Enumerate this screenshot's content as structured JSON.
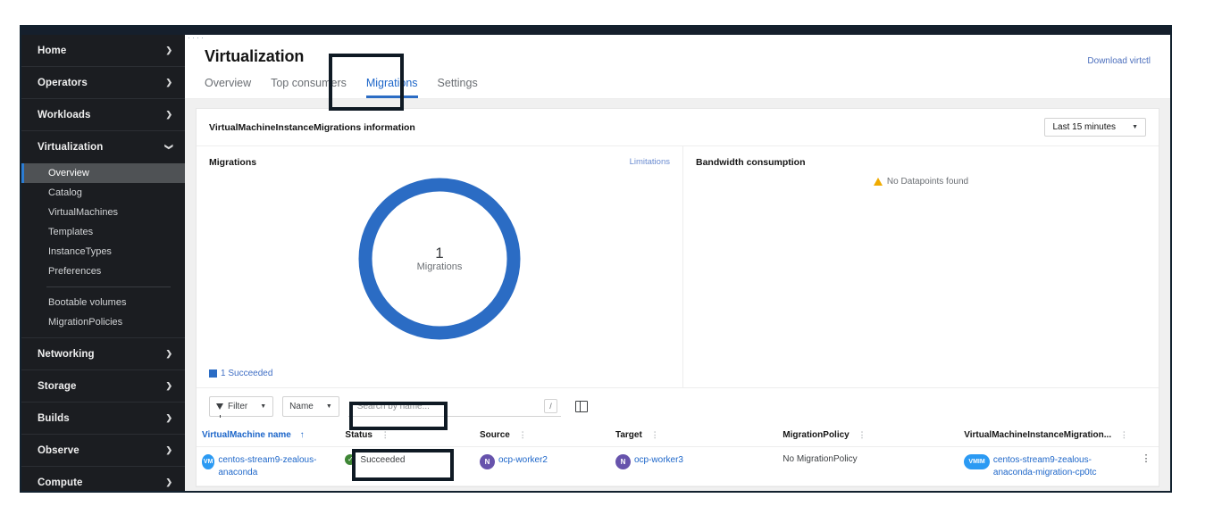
{
  "masthead": {
    "clipped_text": "····"
  },
  "sidebar": {
    "groups": [
      {
        "label": "Home",
        "expanded": false,
        "caret": "chevron-right-icon"
      },
      {
        "label": "Operators",
        "expanded": false,
        "caret": "chevron-right-icon"
      },
      {
        "label": "Workloads",
        "expanded": false,
        "caret": "chevron-right-icon"
      },
      {
        "label": "Virtualization",
        "expanded": true,
        "caret": "chevron-down-icon"
      },
      {
        "label": "Networking",
        "expanded": false,
        "caret": "chevron-right-icon"
      },
      {
        "label": "Storage",
        "expanded": false,
        "caret": "chevron-right-icon"
      },
      {
        "label": "Builds",
        "expanded": false,
        "caret": "chevron-right-icon"
      },
      {
        "label": "Observe",
        "expanded": false,
        "caret": "chevron-right-icon"
      },
      {
        "label": "Compute",
        "expanded": false,
        "caret": "chevron-right-icon"
      }
    ],
    "virtualization_items": [
      {
        "label": "Overview",
        "active": true
      },
      {
        "label": "Catalog",
        "active": false
      },
      {
        "label": "VirtualMachines",
        "active": false
      },
      {
        "label": "Templates",
        "active": false
      },
      {
        "label": "InstanceTypes",
        "active": false
      },
      {
        "label": "Preferences",
        "active": false
      }
    ],
    "virtualization_items_secondary": [
      {
        "label": "Bootable volumes"
      },
      {
        "label": "MigrationPolicies"
      }
    ]
  },
  "header": {
    "title": "Virtualization",
    "download_link": "Download virtctl",
    "tabs": [
      {
        "label": "Overview",
        "active": false
      },
      {
        "label": "Top consumers",
        "active": false
      },
      {
        "label": "Migrations",
        "active": true
      },
      {
        "label": "Settings",
        "active": false
      }
    ]
  },
  "card": {
    "title": "VirtualMachineInstanceMigrations information",
    "time_range": "Last 15 minutes",
    "time_range_caret": "caret-down-icon"
  },
  "migrations_panel": {
    "title": "Migrations",
    "limitations_link": "Limitations",
    "legend": [
      {
        "label": "1 Succeeded",
        "color": "#2b6cc4"
      }
    ]
  },
  "bandwidth_panel": {
    "title": "Bandwidth consumption",
    "empty_text": "No Datapoints found",
    "warning_icon": "warning-triangle-icon",
    "warning_color": "#f0ab00"
  },
  "toolbar": {
    "filter_label": "Filter",
    "filter_icon": "funnel-icon",
    "attribute_label": "Name",
    "search_placeholder": "Search by name...",
    "search_value": "",
    "shortcut_key": "/",
    "columns_icon": "columns-icon"
  },
  "table": {
    "columns": [
      {
        "label": "VirtualMachine name",
        "sorted": true,
        "sort_icon": "arrow-up-icon",
        "link": true
      },
      {
        "label": "Status",
        "sorted": false,
        "sort_icon": "sort-icon"
      },
      {
        "label": "Source",
        "sorted": false,
        "sort_icon": "sort-icon"
      },
      {
        "label": "Target",
        "sorted": false,
        "sort_icon": "sort-icon"
      },
      {
        "label": "MigrationPolicy",
        "sorted": false,
        "sort_icon": "sort-icon"
      },
      {
        "label": "VirtualMachineInstanceMigration...",
        "sorted": false,
        "sort_icon": "sort-icon"
      }
    ],
    "rows": [
      {
        "vm_badge": "VM",
        "vm_name": "centos-stream9-zealous-anaconda",
        "status": "Succeeded",
        "status_icon": "check-circle-icon",
        "status_color": "#3e8635",
        "source_badge": "N",
        "source": "ocp-worker2",
        "target_badge": "N",
        "target": "ocp-worker3",
        "migration_policy": "No MigrationPolicy",
        "vmim_badge": "VMIM",
        "vmim_name": "centos-stream9-zealous-anaconda-migration-cp0tc",
        "actions_icon": "kebab-menu-icon"
      }
    ]
  },
  "chart_data": {
    "type": "pie",
    "title": "Migrations",
    "center_value": "1",
    "center_label": "Migrations",
    "labels": [
      "Succeeded"
    ],
    "values": [
      1
    ],
    "colors": [
      "#2b6cc4"
    ],
    "total": 1,
    "legend_position": "bottom-left"
  }
}
